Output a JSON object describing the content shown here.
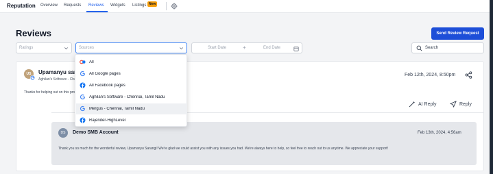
{
  "nav": {
    "brand": "Reputation",
    "tabs": [
      "Overview",
      "Requests",
      "Reviews",
      "Widgets",
      "Listings"
    ],
    "new_badge": "New",
    "active_tab": "Reviews"
  },
  "header": {
    "title": "Reviews",
    "send_button": "Send Review Request"
  },
  "filters": {
    "ratings_placeholder": "Ratings",
    "sources_placeholder": "Sources",
    "start_date": "Start Date",
    "end_date": "End Date",
    "search_placeholder": "Search"
  },
  "sources_dropdown": {
    "options": [
      {
        "label": "All",
        "icon": "google-facebook-icon"
      },
      {
        "label": "All Google pages",
        "icon": "google-icon"
      },
      {
        "label": "All Facebook pages",
        "icon": "facebook-icon"
      },
      {
        "label": "Aghilan's Software - Chennai, Tamil Nadu",
        "icon": "google-icon"
      },
      {
        "label": "Mergus - Chennai, Tamil Nadu",
        "icon": "google-icon",
        "highlighted": true
      },
      {
        "label": "Rajender-HighLevel",
        "icon": "facebook-icon"
      }
    ]
  },
  "review": {
    "avatar_initials": "US",
    "reviewer_name": "Upamanyu sarangi",
    "location": "Aghilan's Software - Chennai, Tamil Nadu",
    "date": "Feb 12th, 2024, 8:50pm",
    "text": "Thanks for helping out on this project!",
    "ai_reply_label": "AI Reply",
    "reply_label": "Reply"
  },
  "response": {
    "avatar_initials": "DS",
    "business_name": "Demo SMB Account",
    "date": "Feb 13th, 2024, 4:56am",
    "text": "Thank you so much for the wonderful review, Upamanyu Sarangi! We're glad we could assist you with any issues you had. We're always here to help, so feel free to reach out to us anytime. We appreciate your support!"
  },
  "colors": {
    "accent": "#2563eb",
    "button": "#1d4ed8",
    "badge": "#f59e0b"
  }
}
